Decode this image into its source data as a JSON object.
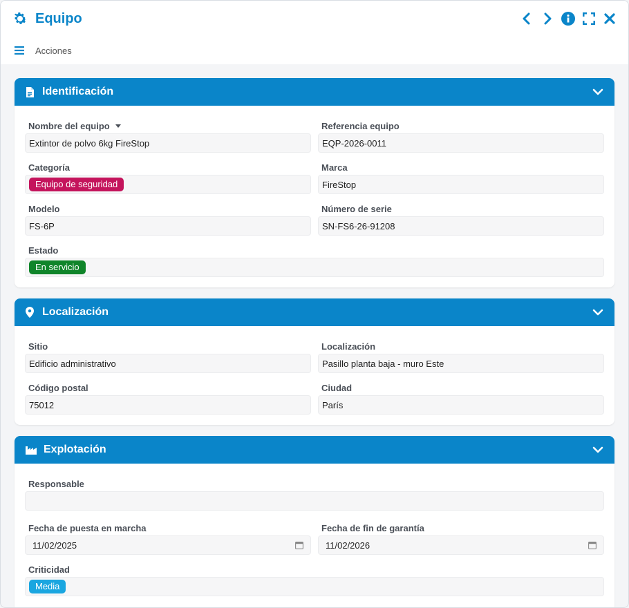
{
  "window": {
    "title": "Equipo",
    "menu_label": "Acciones"
  },
  "colors": {
    "accent": "#0a85c9",
    "tag_categoria": "#c4145c",
    "tag_estado": "#10852a",
    "tag_criticidad": "#1aa6e0"
  },
  "sections": {
    "identificacion": {
      "title": "Identificación",
      "nombre_label": "Nombre del equipo",
      "nombre_value": "Extintor de polvo 6kg FireStop",
      "referencia_label": "Referencia equipo",
      "referencia_value": "EQP-2026-0011",
      "categoria_label": "Categoría",
      "categoria_value": "Equipo de seguridad",
      "marca_label": "Marca",
      "marca_value": "FireStop",
      "modelo_label": "Modelo",
      "modelo_value": "FS-6P",
      "serie_label": "Número de serie",
      "serie_value": "SN-FS6-26-91208",
      "estado_label": "Estado",
      "estado_value": "En servicio"
    },
    "localizacion": {
      "title": "Localización",
      "sitio_label": "Sitio",
      "sitio_value": "Edificio administrativo",
      "localizacion_label": "Localización",
      "localizacion_value": "Pasillo planta baja - muro Este",
      "cp_label": "Código postal",
      "cp_value": "75012",
      "ciudad_label": "Ciudad",
      "ciudad_value": "París"
    },
    "explotacion": {
      "title": "Explotación",
      "responsable_label": "Responsable",
      "responsable_value": "",
      "puesta_label": "Fecha de puesta en marcha",
      "puesta_value": "11/02/2025",
      "garantia_label": "Fecha de fin de garantía",
      "garantia_value": "11/02/2026",
      "criticidad_label": "Criticidad",
      "criticidad_value": "Media"
    }
  },
  "icons": {
    "title": "gear-icon",
    "nav": [
      "chevron-left-icon",
      "chevron-right-icon",
      "info-icon",
      "fullscreen-icon",
      "close-icon"
    ],
    "menu": "hamburger-icon",
    "sections": [
      "document-icon",
      "map-pin-icon",
      "factory-icon"
    ],
    "collapse": "chevron-down-icon",
    "date": "calendar-icon"
  }
}
